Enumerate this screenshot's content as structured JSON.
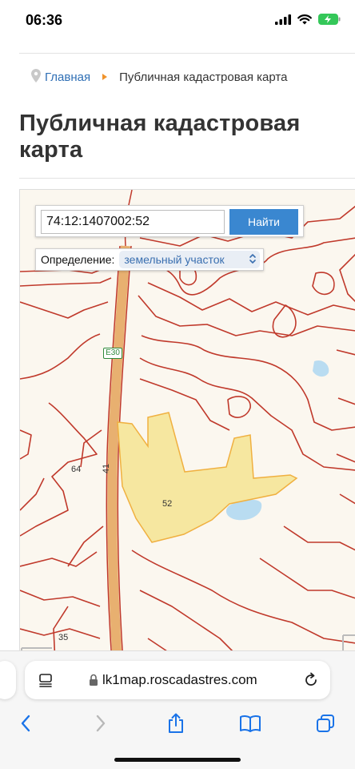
{
  "status_bar": {
    "time": "06:36"
  },
  "breadcrumb": {
    "home": "Главная",
    "current": "Публичная кадастровая карта"
  },
  "page": {
    "title": "Публичная кадастровая карта"
  },
  "map": {
    "search_value": "74:12:1407002:52",
    "search_button": "Найти",
    "definition_label": "Определение:",
    "definition_value": "земельный участок",
    "road_sign": "E30",
    "labels": {
      "road_number": "41",
      "parcel_52": "52",
      "parcel_64": "64",
      "parcel_35": "35"
    },
    "colors": {
      "boundary": "#c0392b",
      "parcel_fill": "#f6e7a0",
      "water": "#b9dcf1",
      "road": "#e8b070"
    }
  },
  "browser": {
    "url": "lk1map.roscadastres.com"
  },
  "icons": [
    "location-pin-icon",
    "breadcrumb-arrow-icon",
    "signal-icon",
    "wifi-icon",
    "battery-charging-icon",
    "chevron-updown-icon",
    "tabs-list-icon",
    "lock-icon",
    "reload-icon",
    "back-icon",
    "forward-icon",
    "share-icon",
    "bookmarks-icon",
    "tabs-icon"
  ]
}
